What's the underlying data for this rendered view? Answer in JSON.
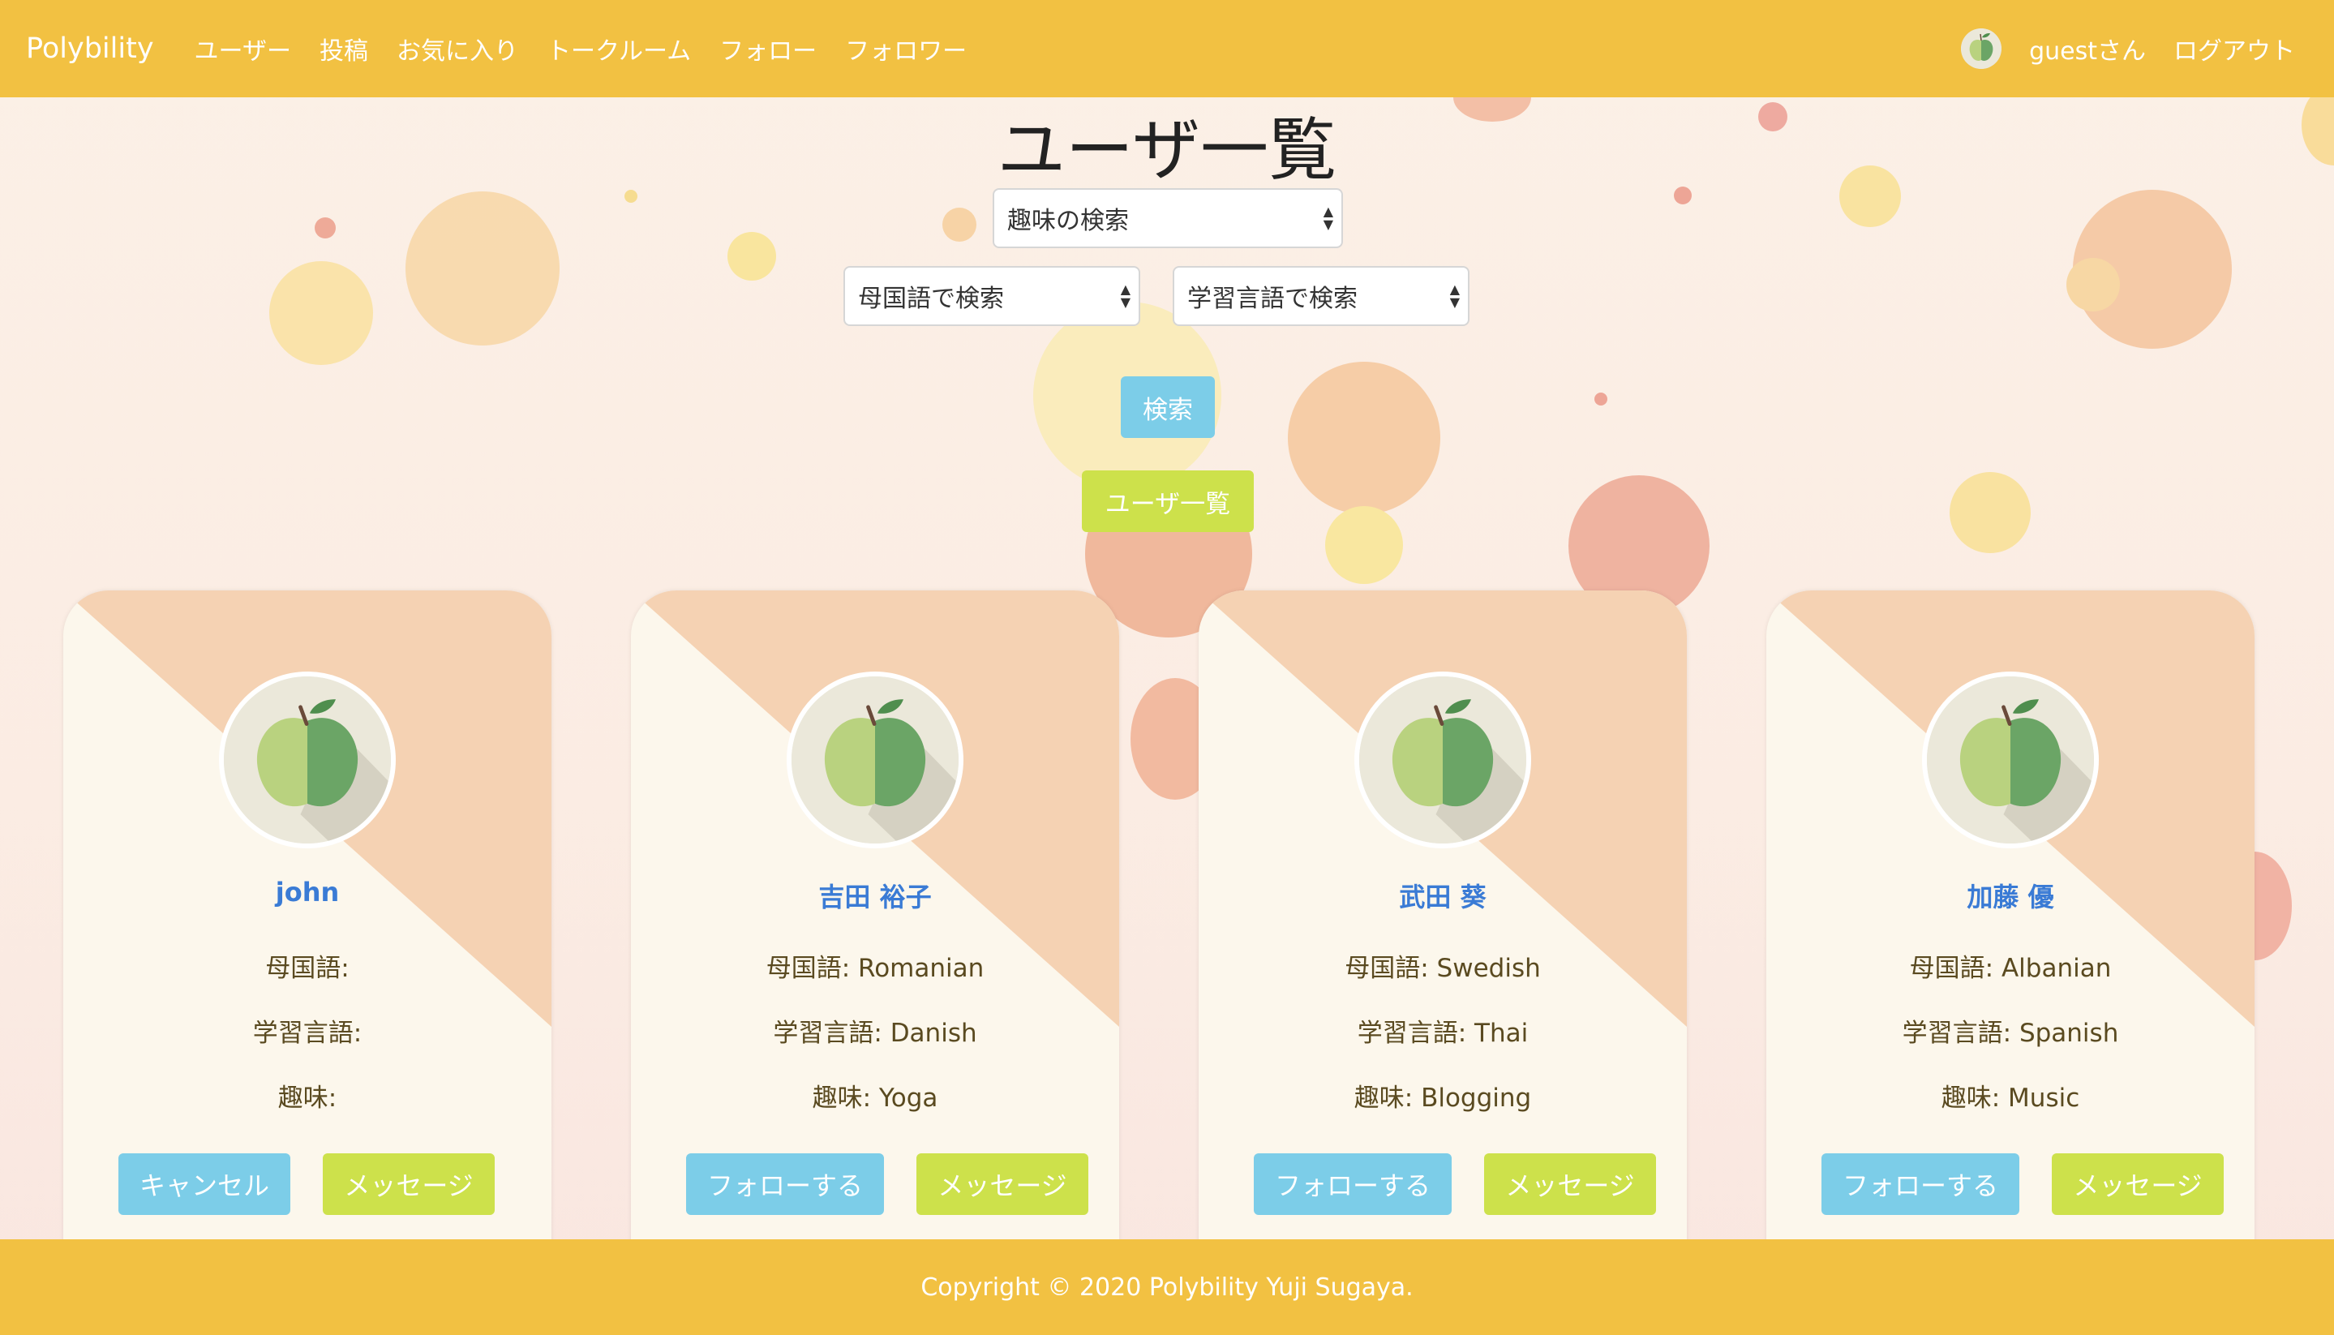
{
  "nav": {
    "brand": "Polybility",
    "links": [
      "ユーザー",
      "投稿",
      "お気に入り",
      "トークルーム",
      "フォロー",
      "フォロワー"
    ],
    "user_label": "guestさん",
    "logout": "ログアウト"
  },
  "page_title": "ユーザ一覧",
  "search": {
    "hobby_select": "趣味の検索",
    "native_select": "母国語で検索",
    "learning_select": "学習言語で検索",
    "search_button": "検索",
    "list_button": "ユーザ一覧"
  },
  "labels": {
    "native": "母国語:",
    "learning": "学習言語:",
    "hobby": "趣味:"
  },
  "users": [
    {
      "name": "john",
      "native": "",
      "learning": "",
      "hobby": "",
      "follow_label": "キャンセル",
      "message_label": "メッセージ"
    },
    {
      "name": "吉田 裕子",
      "native": "Romanian",
      "learning": "Danish",
      "hobby": "Yoga",
      "follow_label": "フォローする",
      "message_label": "メッセージ"
    },
    {
      "name": "武田 葵",
      "native": "Swedish",
      "learning": "Thai",
      "hobby": "Blogging",
      "follow_label": "フォローする",
      "message_label": "メッセージ"
    },
    {
      "name": "加藤 優",
      "native": "Albanian",
      "learning": "Spanish",
      "hobby": "Music",
      "follow_label": "フォローする",
      "message_label": "メッセージ"
    }
  ],
  "footer": "Copyright © 2020 Polybility Yuji Sugaya.",
  "colors": {
    "nav": "#f2c142",
    "info_button": "#7ccde8",
    "lime_button": "#cde14b",
    "name_link": "#3a7bd5",
    "card_accent": "#f5d2b3"
  },
  "icons": {
    "avatar": "green-apple-icon"
  }
}
